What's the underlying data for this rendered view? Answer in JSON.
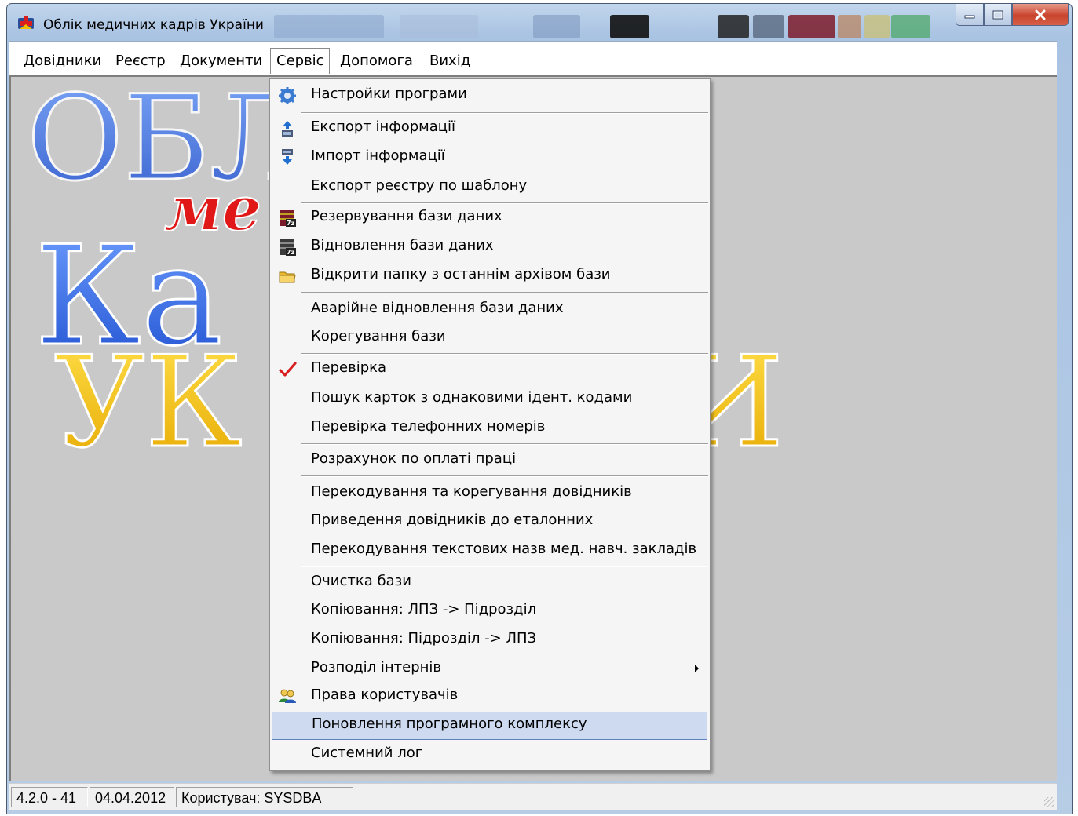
{
  "window": {
    "title": "Облік медичних кадрів України"
  },
  "menubar": {
    "items": [
      {
        "label": "Довідники"
      },
      {
        "label": "Реєстр"
      },
      {
        "label": "Документи"
      },
      {
        "label": "Сервіс"
      },
      {
        "label": "Допомога"
      },
      {
        "label": "Вихід"
      }
    ]
  },
  "background": {
    "logo_line1": "ОБЛ",
    "logo_word2": "ме",
    "logo_line3": "Ка",
    "logo_line4_left": "УК",
    "logo_line4_right": "И"
  },
  "service_menu": {
    "items": [
      {
        "label": "Настройки програми",
        "icon": "gear-icon"
      },
      {
        "label": "Експорт інформації",
        "icon": "export-icon"
      },
      {
        "label": "Імпорт інформації",
        "icon": "import-icon"
      },
      {
        "label": "Експорт реєстру по шаблону"
      },
      {
        "label": "Резервування бази даних",
        "icon": "archive-7z-icon"
      },
      {
        "label": "Відновлення бази даних",
        "icon": "archive-7z-icon"
      },
      {
        "label": "Відкрити папку з останнім архівом бази",
        "icon": "folder-icon"
      },
      {
        "label": "Аварійне відновлення бази даних"
      },
      {
        "label": "Корегування бази"
      },
      {
        "label": "Перевірка",
        "icon": "checkmark-icon"
      },
      {
        "label": "Пошук карток з однаковими ідент. кодами"
      },
      {
        "label": "Перевірка телефонних номерів"
      },
      {
        "label": "Розрахунок по оплаті праці"
      },
      {
        "label": "Перекодування та корегування довідників"
      },
      {
        "label": "Приведення довідників до еталонних"
      },
      {
        "label": "Перекодування текстових назв мед. навч. закладів"
      },
      {
        "label": "Очистка бази"
      },
      {
        "label": "Копіювання: ЛПЗ -> Підрозділ"
      },
      {
        "label": "Копіювання: Підрозділ -> ЛПЗ"
      },
      {
        "label": "Розподіл інтернів",
        "submenu": true
      },
      {
        "label": "Права користувачів",
        "icon": "users-icon"
      },
      {
        "label": "Поновлення програмного комплексу",
        "highlighted": true
      },
      {
        "label": "Системний лог"
      }
    ]
  },
  "statusbar": {
    "version": "4.2.0 - 41",
    "date": "04.04.2012",
    "user": "Користувач: SYSDBA"
  },
  "colors": {
    "highlight_bg": "#cddaf0",
    "highlight_border": "#5f82bd",
    "client_bg": "#c9c9c9",
    "logo_blue": "#3a6fe0",
    "logo_red": "#e01818",
    "logo_yellow": "#f5c800"
  }
}
